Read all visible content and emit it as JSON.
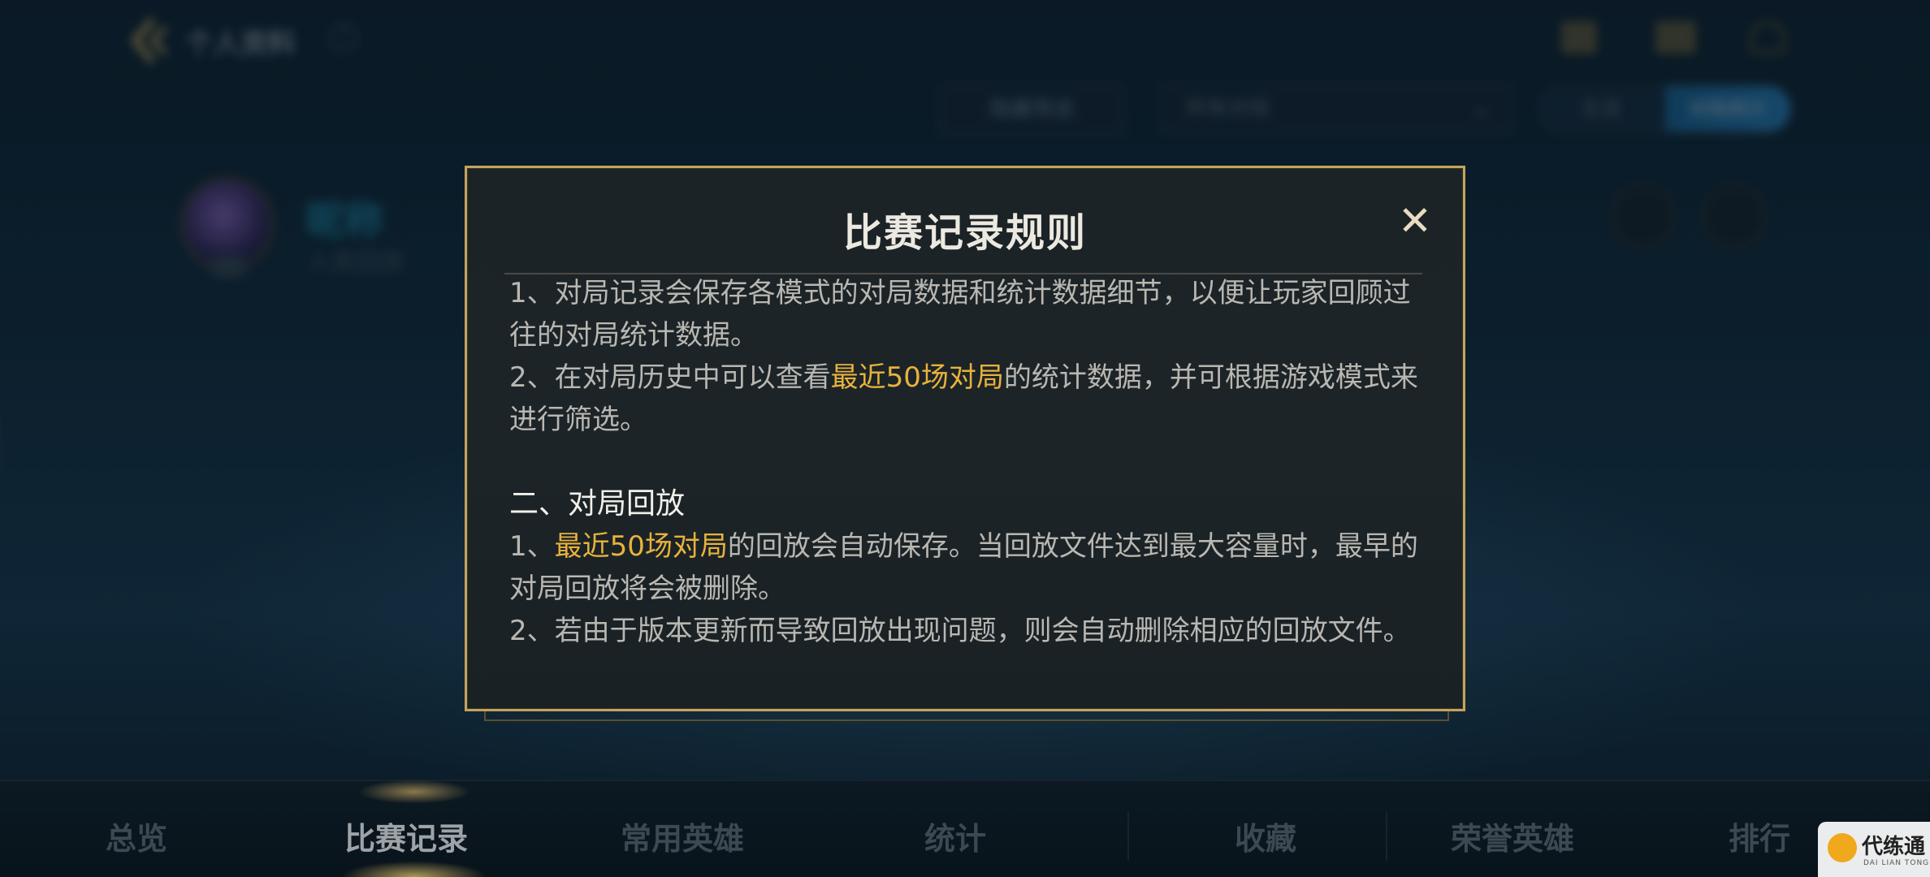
{
  "background": {
    "page_title": "个人资料",
    "help_icon": "?",
    "filter_button_label": "隐藏筛选",
    "mode_select_value": "所有对局",
    "toggle_options": [
      "生涯",
      "对局统计"
    ],
    "player_name": "昵称",
    "player_subtitle": "人类回放",
    "side_id": "2162088",
    "bottom_tabs": [
      "总览",
      "比赛记录",
      "常用英雄",
      "统计",
      "收藏",
      "荣誉英雄",
      "排行"
    ]
  },
  "modal": {
    "title": "比赛记录规则",
    "close_label": "✕",
    "section1": {
      "item1": "1、对局记录会保存各模式的对局数据和统计数据细节，以便让玩家回顾过往的对局统计数据。",
      "item2_prefix": "2、在对局历史中可以查看",
      "item2_highlight": "最近50场对局",
      "item2_suffix": "的统计数据，并可根据游戏模式来进行筛选。"
    },
    "section2": {
      "title": "二、对局回放",
      "item1_prefix": "1、",
      "item1_highlight": "最近50场对局",
      "item1_suffix": "的回放会自动保存。当回放文件达到最大容量时，最早的对局回放将会被删除。",
      "item2": "2、若由于版本更新而导致回放出现问题，则会自动删除相应的回放文件。"
    }
  },
  "watermark": {
    "text": "代练通",
    "sub": "DAI LIAN TONG"
  },
  "colors": {
    "modal_border": "#c2a45e",
    "highlight": "#e8b23c",
    "title_text": "#ece9e1",
    "body_text": "#b9b7b1"
  },
  "icons": {
    "back": "back-chevron-icon",
    "close": "close-icon",
    "help": "help-icon"
  }
}
